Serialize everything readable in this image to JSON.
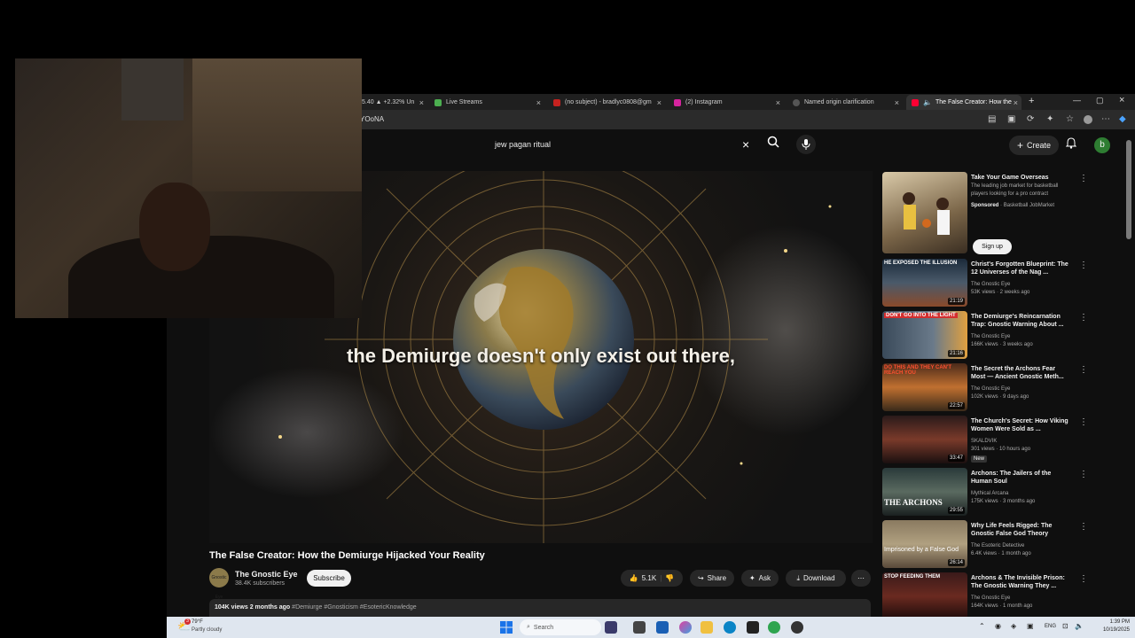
{
  "tabs": [
    {
      "label": "5.40 ▲ +2.32% Un",
      "active": false
    },
    {
      "label": "Live Streams",
      "active": false
    },
    {
      "label": "(no subject) - bradlyc0808@gm",
      "active": false
    },
    {
      "label": "(2) Instagram",
      "active": false
    },
    {
      "label": "Named origin clarification",
      "active": false
    },
    {
      "label": "The False Creator: How the",
      "active": true
    }
  ],
  "address": {
    "text": "YOoNA"
  },
  "search": {
    "query": "jew pagan ritual"
  },
  "header": {
    "create_label": "Create",
    "avatar_letter": "b"
  },
  "player": {
    "caption": "the Demiurge doesn't only exist out there,"
  },
  "video": {
    "title": "The False Creator: How the Demiurge Hijacked Your Reality",
    "channel_name": "The Gnostic Eye",
    "channel_avatar_text": "Gnostic Eye",
    "subscribers": "38.4K subscribers",
    "subscribe_label": "Subscribe",
    "likes": "5.1K",
    "share_label": "Share",
    "ask_label": "Ask",
    "download_label": "Download",
    "views": "104K views",
    "age": "2 months ago",
    "tags": "#Demiurge #Gnosticism #EsotericKnowledge"
  },
  "sidebar": {
    "ad": {
      "title": "Take Your Game Overseas",
      "description": "The leading job market for basketball players looking for a pro contract",
      "sponsored": "Sponsored",
      "advertiser": "Basketball JobMarket",
      "cta": "Sign up"
    },
    "items": [
      {
        "title": "Christ's Forgotten Blueprint: The 12 Universes of the Nag ...",
        "channel": "The Gnostic Eye",
        "meta": "53K views · 2 weeks ago",
        "duration": "21:19",
        "thumb_text": "HE EXPOSED THE ILLUSION",
        "badge": ""
      },
      {
        "title": "The Demiurge's Reincarnation Trap: Gnostic Warning About ...",
        "channel": "The Gnostic Eye",
        "meta": "166K views · 3 weeks ago",
        "duration": "21:16",
        "thumb_text": "DON'T GO INTO THE LIGHT",
        "badge": ""
      },
      {
        "title": "The Secret the Archons Fear Most — Ancient Gnostic Meth...",
        "channel": "The Gnostic Eye",
        "meta": "102K views · 9 days ago",
        "duration": "22:57",
        "thumb_text": "DO THIS AND THEY CAN'T REACH YOU",
        "badge": ""
      },
      {
        "title": "The Church's Secret: How Viking Women Were Sold as ...",
        "channel": "SKALDVIK",
        "meta": "301 views · 10 hours ago",
        "duration": "33:47",
        "thumb_text": "",
        "badge": "New"
      },
      {
        "title": "Archons: The Jailers of the Human Soul",
        "channel": "Mythical Arcana",
        "meta": "175K views · 3 months ago",
        "duration": "29:55",
        "thumb_text": "THE ARCHONS",
        "badge": ""
      },
      {
        "title": "Why Life Feels Rigged: The Gnostic False God Theory",
        "channel": "The Esoteric Detective",
        "meta": "6.4K views · 1 month ago",
        "duration": "26:14",
        "thumb_text": "Imprisoned by a False God",
        "badge": ""
      },
      {
        "title": "Archons & The Invisible Prison: The Gnostic Warning They ...",
        "channel": "The Gnostic Eye",
        "meta": "164K views · 1 month ago",
        "duration": "",
        "thumb_text": "STOP FEEDING THEM",
        "badge": ""
      }
    ]
  },
  "taskbar": {
    "weather_badge": "3",
    "temperature": "79°F",
    "weather": "Partly cloudy",
    "search_label": "Search",
    "language": "ENG",
    "time": "1:39 PM",
    "date": "10/19/2025"
  },
  "colors": {
    "accent_red": "#ff0033",
    "background": "#0f0f0f",
    "avatar_green": "#2e7d32"
  }
}
